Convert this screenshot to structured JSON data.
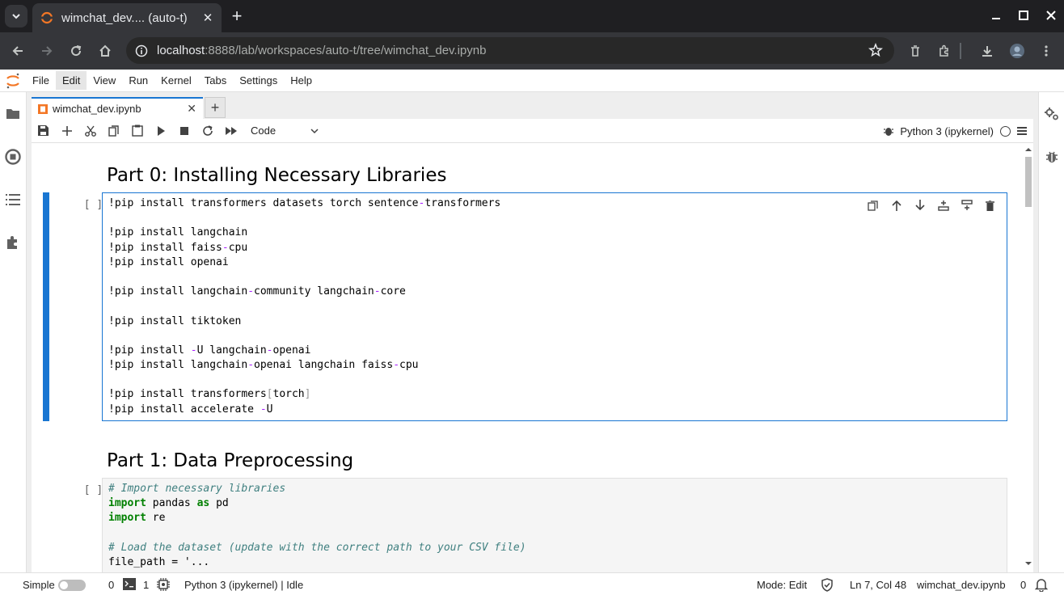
{
  "browser": {
    "tab_title": "wimchat_dev.... (auto-t)",
    "url_host": "localhost",
    "url_path": ":8888/lab/workspaces/auto-t/tree/wimchat_dev.ipynb",
    "new_tab_symbol": "+",
    "close_symbol": "✕"
  },
  "menubar": {
    "items": [
      "File",
      "Edit",
      "View",
      "Run",
      "Kernel",
      "Tabs",
      "Settings",
      "Help"
    ],
    "active_index": 1
  },
  "document_tab": {
    "title": "wimchat_dev.ipynb"
  },
  "notebook_toolbar": {
    "cell_type": "Code",
    "kernel_name": "Python 3 (ipykernel)"
  },
  "notebook": {
    "heading_0": "Part 0: Installing Necessary Libraries",
    "cell_0_prompt": "[ ]:",
    "cell_0_lines": [
      "!pip install transformers datasets torch sentence-transformers",
      "",
      "!pip install langchain",
      "!pip install faiss-cpu",
      "!pip install openai",
      "",
      "!pip install langchain-community langchain-core",
      "",
      "!pip install tiktoken",
      "",
      "!pip install -U langchain-openai",
      "!pip install langchain-openai langchain faiss-cpu",
      "",
      "!pip install transformers[torch]",
      "!pip install accelerate -U"
    ],
    "heading_1": "Part 1: Data Preprocessing",
    "cell_1_prompt": "[ ]:",
    "cell_1_lines": [
      "# Import necessary libraries",
      "import pandas as pd",
      "import re",
      "",
      "# Load the dataset (update with the correct path to your CSV file)",
      "file_path = '..."
    ]
  },
  "statusbar": {
    "mode_label": "Simple",
    "terminals_count": "0",
    "kernels_count": "1",
    "kernel_status": "Python 3 (ipykernel) | Idle",
    "mode": "Mode: Edit",
    "cursor": "Ln 7, Col 48",
    "filename": "wimchat_dev.ipynb",
    "notifications": "0"
  },
  "colors": {
    "accent": "#1976d2",
    "browser_bg": "#35363a",
    "jupyter_orange": "#f37726"
  }
}
